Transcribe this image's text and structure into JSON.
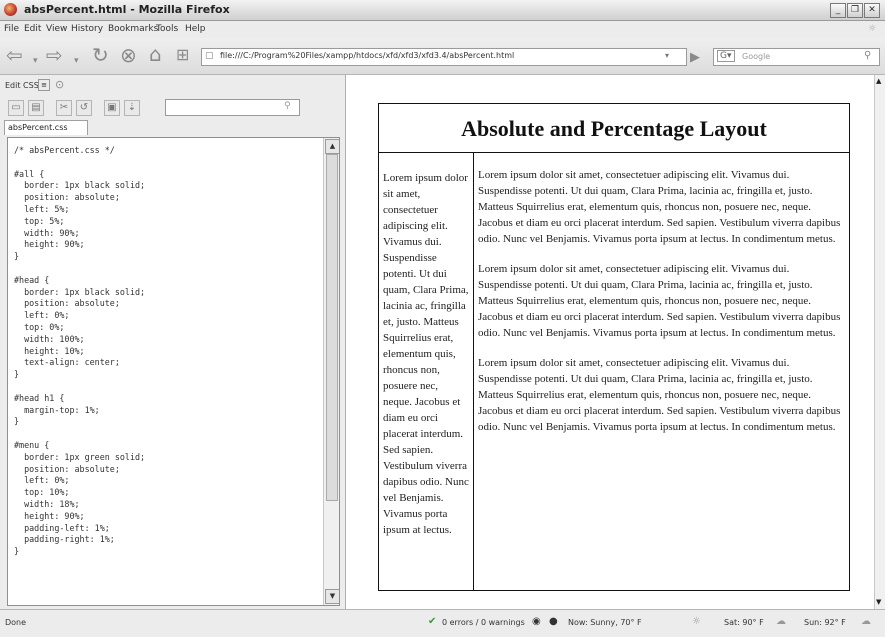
{
  "window": {
    "title": "absPercent.html - Mozilla Firefox"
  },
  "menubar": {
    "items": [
      "File",
      "Edit",
      "View",
      "History",
      "Bookmarks",
      "Tools",
      "Help"
    ]
  },
  "nav": {
    "url": "file:///C:/Program%20Files/xampp/htdocs/xfd/xfd3/xfd3.4/absPercent.html",
    "search_placeholder": "Google"
  },
  "side": {
    "header": "Edit CSS",
    "tab": "absPercent.css"
  },
  "css_code": "/* absPercent.css */\n\n#all {\n  border: 1px black solid;\n  position: absolute;\n  left: 5%;\n  top: 5%;\n  width: 90%;\n  height: 90%;\n}\n\n#head {\n  border: 1px black solid;\n  position: absolute;\n  left: 0%;\n  top: 0%;\n  width: 100%;\n  height: 10%;\n  text-align: center;\n}\n\n#head h1 {\n  margin-top: 1%;\n}\n\n#menu {\n  border: 1px green solid;\n  position: absolute;\n  left: 0%;\n  top: 10%;\n  width: 18%;\n  height: 90%;\n  padding-left: 1%;\n  padding-right: 1%;\n}",
  "page": {
    "heading": "Absolute and Percentage Layout",
    "menu_text": "Lorem ipsum dolor sit amet, consectetuer adipiscing elit. Vivamus dui. Suspendisse potenti. Ut dui quam, Clara Prima, lacinia ac, fringilla et, justo. Matteus Squirrelius erat, elementum quis, rhoncus non, posuere nec, neque. Jacobus et diam eu orci placerat interdum. Sed sapien. Vestibulum viverra dapibus odio. Nunc vel Benjamis. Vivamus porta ipsum at lectus.",
    "main_paragraphs": [
      "Lorem ipsum dolor sit amet, consectetuer adipiscing elit. Vivamus dui. Suspendisse potenti. Ut dui quam, Clara Prima, lacinia ac, fringilla et, justo. Matteus Squirrelius erat, elementum quis, rhoncus non, posuere nec, neque. Jacobus et diam eu orci placerat interdum. Sed sapien. Vestibulum viverra dapibus odio. Nunc vel Benjamis. Vivamus porta ipsum at lectus. In condimentum metus.",
      "Lorem ipsum dolor sit amet, consectetuer adipiscing elit. Vivamus dui. Suspendisse potenti. Ut dui quam, Clara Prima, lacinia ac, fringilla et, justo. Matteus Squirrelius erat, elementum quis, rhoncus non, posuere nec, neque. Jacobus et diam eu orci placerat interdum. Sed sapien. Vestibulum viverra dapibus odio. Nunc vel Benjamis. Vivamus porta ipsum at lectus. In condimentum metus.",
      "Lorem ipsum dolor sit amet, consectetuer adipiscing elit. Vivamus dui. Suspendisse potenti. Ut dui quam, Clara Prima, lacinia ac, fringilla et, justo. Matteus Squirrelius erat, elementum quis, rhoncus non, posuere nec, neque. Jacobus et diam eu orci placerat interdum. Sed sapien. Vestibulum viverra dapibus odio. Nunc vel Benjamis. Vivamus porta ipsum at lectus. In condimentum metus."
    ]
  },
  "status": {
    "left": "Done",
    "errors": "0 errors / 0 warnings",
    "weather_now": "Now: Sunny, 70° F",
    "weather_sat": "Sat: 90° F",
    "weather_sun": "Sun: 92° F"
  },
  "icons": {
    "back": "back-arrow-icon",
    "forward": "forward-arrow-icon",
    "reload": "reload-icon",
    "stop": "stop-icon",
    "home": "home-icon",
    "bookmark": "new-tab-icon"
  }
}
